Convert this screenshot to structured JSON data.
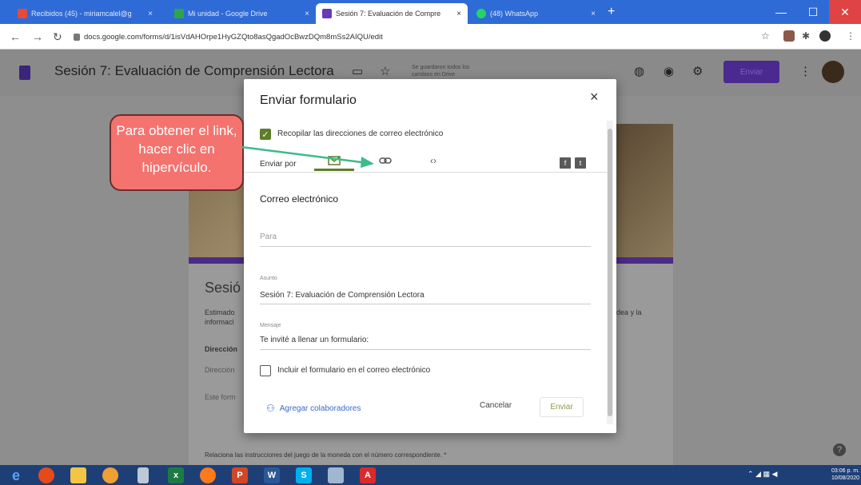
{
  "browser": {
    "tabs": [
      {
        "label": "Recibidos (45) - miriamcalel@g",
        "close": "×"
      },
      {
        "label": "Mi unidad - Google Drive",
        "close": "×"
      },
      {
        "label": "Sesión 7: Evaluación de Compre",
        "close": "×"
      },
      {
        "label": "(48) WhatsApp",
        "close": "×"
      }
    ],
    "new_tab": "+",
    "url": "docs.google.com/forms/d/1isVdAHOrpe1HyGZQto8asQgadOcBwzDQm8mSs2AIQU/edit",
    "window_controls": {
      "minimize": "—",
      "maximize": "☐",
      "close": "✕"
    }
  },
  "forms_header": {
    "title": "Sesión 7: Evaluación de Comprensión Lectora",
    "saved_status": "Se guardaron todos los cambios en Drive",
    "send_label": "Enviar"
  },
  "background_form": {
    "title_partial": "Sesió",
    "desc_partial_1": "Estimado",
    "desc_partial_2": "informaci",
    "desc_right": "dea y la",
    "dir_label": "Dirección",
    "dir_value": "Dirección",
    "notice": "Este form",
    "question": "Relaciona las instrucciones del juego de la moneda con el número correspondiente. *"
  },
  "dialog": {
    "title": "Enviar formulario",
    "close": "×",
    "collect_emails_label": "Recopilar las direcciones de correo electrónico",
    "send_via_label": "Enviar por",
    "section_title": "Correo electrónico",
    "to_placeholder": "Para",
    "subject_label": "Asunto",
    "subject_value": "Sesión 7: Evaluación de Comprensión Lectora",
    "message_label": "Mensaje",
    "message_value": "Te invité a llenar un formulario:",
    "include_form_label": "Incluir el formulario en el correo electrónico",
    "add_collaborators": "Agregar colaboradores",
    "cancel": "Cancelar",
    "send": "Enviar"
  },
  "callout": {
    "text": "Para obtener el link, hacer clic en hipervículo."
  },
  "taskbar": {
    "clock_time": "03:06 p. m.",
    "clock_date": "10/08/2020"
  },
  "colors": {
    "chrome_blue": "#2f6bd6",
    "forms_purple": "#4a2c86",
    "check_green": "#5f7d2a",
    "callout_red": "#f4736f",
    "taskbar": "#1e3f76"
  }
}
